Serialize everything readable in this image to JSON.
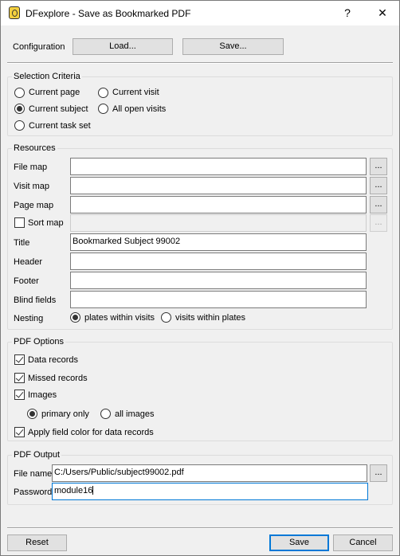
{
  "window": {
    "title": "DFexplore - Save as Bookmarked PDF",
    "help_glyph": "?",
    "close_glyph": "✕"
  },
  "configuration": {
    "label": "Configuration",
    "load_label": "Load...",
    "save_label": "Save..."
  },
  "selection": {
    "title": "Selection Criteria",
    "options": {
      "current_page": "Current page",
      "current_visit": "Current visit",
      "current_subject": "Current subject",
      "all_open_visits": "All open visits",
      "current_task_set": "Current task set"
    },
    "selected": "Current subject"
  },
  "resources": {
    "title": "Resources",
    "file_map_label": "File map",
    "visit_map_label": "Visit map",
    "page_map_label": "Page map",
    "sort_map_label": "Sort map",
    "sort_map_checked": false,
    "title_label": "Title",
    "title_value": "Bookmarked Subject 99002",
    "header_label": "Header",
    "footer_label": "Footer",
    "blind_fields_label": "Blind fields",
    "nesting_label": "Nesting",
    "nesting_opt1": "plates within visits",
    "nesting_opt2": "visits within plates",
    "nesting_selected": "plates within visits",
    "browse_label": "..."
  },
  "pdf_options": {
    "title": "PDF Options",
    "data_records": "Data records",
    "missed_records": "Missed records",
    "images": "Images",
    "primary_only": "primary only",
    "all_images": "all images",
    "image_selected": "primary only",
    "apply_field_color": "Apply field color for data records",
    "checked": {
      "data_records": true,
      "missed_records": true,
      "images": true,
      "apply_field_color": true
    }
  },
  "pdf_output": {
    "title": "PDF Output",
    "file_name_label": "File name",
    "file_name_value": "C:/Users/Public/subject99002.pdf",
    "password_label": "Password",
    "password_value": "module16",
    "browse_label": "..."
  },
  "footer": {
    "reset_label": "Reset",
    "save_label": "Save",
    "cancel_label": "Cancel"
  },
  "colors": {
    "window_bg": "#f0f0f0",
    "focus_accent": "#0078d7"
  }
}
